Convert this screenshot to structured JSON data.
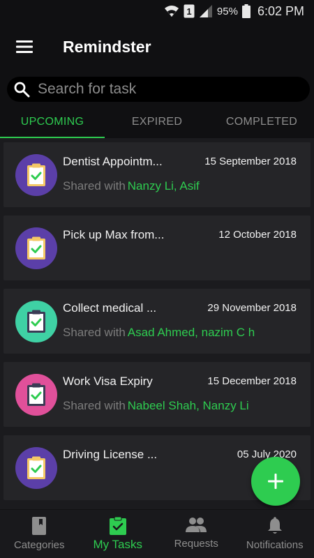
{
  "status_bar": {
    "battery": "95%",
    "time": "6:02 PM",
    "sim_badge": "1"
  },
  "app": {
    "title": "Remindster"
  },
  "search": {
    "placeholder": "Search for task"
  },
  "tabs": [
    {
      "label": "UPCOMING",
      "active": true
    },
    {
      "label": "EXPIRED",
      "active": false
    },
    {
      "label": "COMPLETED",
      "active": false
    }
  ],
  "tasks": [
    {
      "title": "Dentist Appointm...",
      "date": "15 September 2018",
      "shared_label": "Shared with",
      "shared_with": "Nanzy Li, Asif",
      "color": "#5b3fa8"
    },
    {
      "title": "Pick up Max from...",
      "date": "12 October 2018",
      "shared_label": "",
      "shared_with": "",
      "color": "#5b3fa8"
    },
    {
      "title": "Collect medical ...",
      "date": "29 November 2018",
      "shared_label": "Shared with",
      "shared_with": "Asad Ahmed, nazim C h",
      "color": "#3fd1a4"
    },
    {
      "title": "Work Visa Expiry",
      "date": "15 December 2018",
      "shared_label": "Shared with",
      "shared_with": "Nabeel Shah, Nanzy Li",
      "color": "#e0509a"
    },
    {
      "title": "Driving License ...",
      "date": "05 July 2020",
      "shared_label": "",
      "shared_with": "",
      "color": "#5b3fa8"
    }
  ],
  "bottom_nav": [
    {
      "label": "Categories",
      "icon": "book-icon",
      "active": false
    },
    {
      "label": "My Tasks",
      "icon": "clipboard-check-icon",
      "active": true
    },
    {
      "label": "Requests",
      "icon": "people-icon",
      "active": false
    },
    {
      "label": "Notifications",
      "icon": "bell-icon",
      "active": false
    }
  ],
  "colors": {
    "accent": "#2ecc50",
    "background": "#1b1b1e",
    "card": "#252528"
  }
}
